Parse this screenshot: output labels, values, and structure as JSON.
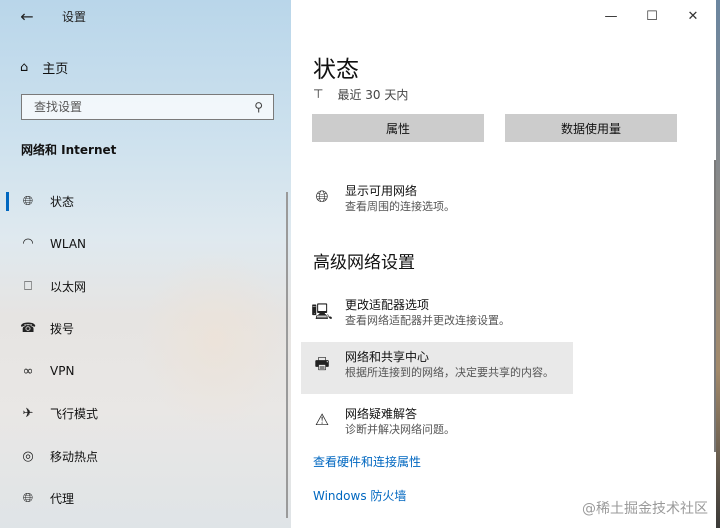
{
  "window": {
    "title": "设置",
    "controls": {
      "minimize": "—",
      "maximize": "☐",
      "close": "✕"
    }
  },
  "sidebar": {
    "home_label": "主页",
    "search_placeholder": "查找设置",
    "section_label": "网络和 Internet",
    "items": [
      {
        "label": "状态",
        "icon": "globe-icon",
        "active": true
      },
      {
        "label": "WLAN",
        "icon": "wifi-icon",
        "active": false
      },
      {
        "label": "以太网",
        "icon": "ethernet-icon",
        "active": false
      },
      {
        "label": "拨号",
        "icon": "dialup-icon",
        "active": false
      },
      {
        "label": "VPN",
        "icon": "vpn-icon",
        "active": false
      },
      {
        "label": "飞行模式",
        "icon": "airplane-icon",
        "active": false
      },
      {
        "label": "移动热点",
        "icon": "hotspot-icon",
        "active": false
      },
      {
        "label": "代理",
        "icon": "globe-icon",
        "active": false
      }
    ]
  },
  "main": {
    "title": "状态",
    "usage_text": "最近 30 天内",
    "buttons": {
      "properties": "属性",
      "data_usage": "数据使用量"
    },
    "show_networks": {
      "title": "显示可用网络",
      "desc": "查看周围的连接选项。"
    },
    "advanced_heading": "高级网络设置",
    "advanced_items": [
      {
        "title": "更改适配器选项",
        "desc": "查看网络适配器并更改连接设置。",
        "icon": "adapter-icon"
      },
      {
        "title": "网络和共享中心",
        "desc": "根据所连接到的网络，决定要共享的内容。",
        "icon": "sharing-center-icon"
      },
      {
        "title": "网络疑难解答",
        "desc": "诊断并解决网络问题。",
        "icon": "warning-icon"
      }
    ],
    "links": {
      "hardware": "查看硬件和连接属性",
      "firewall": "Windows 防火墙"
    }
  },
  "watermark": "@稀土掘金技术社区",
  "colors": {
    "accent": "#0067c0",
    "button_bg": "#cccccc",
    "hover_bg": "#e9e9e9"
  }
}
